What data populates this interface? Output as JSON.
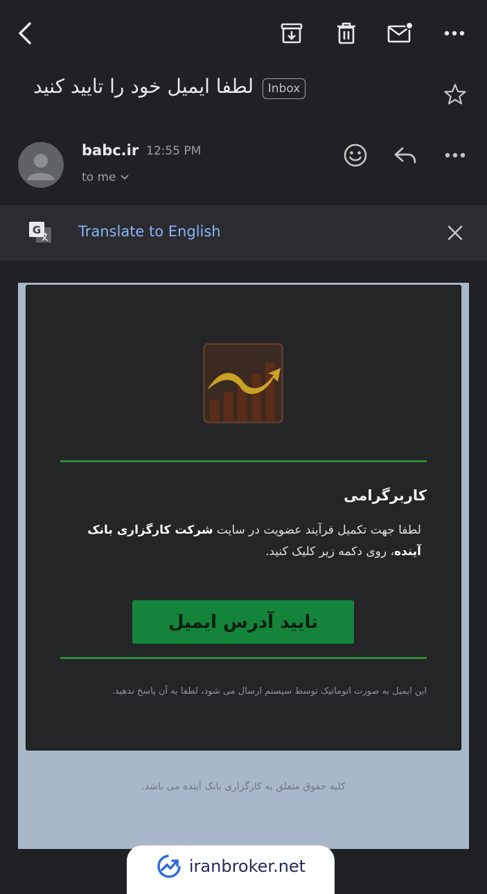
{
  "toolbar": {
    "back": "back-arrow-icon",
    "archive": "archive-icon",
    "delete": "trash-icon",
    "mark_unread": "mail-unread-icon",
    "more": "more-vert-icon"
  },
  "subject": {
    "text": "لطفا ایمیل خود را تایید کنید",
    "label": "Inbox"
  },
  "sender": {
    "name": "babc.ir",
    "time": "12:55 PM",
    "recipient": "to me"
  },
  "translate": {
    "link_text": "Translate to English"
  },
  "email": {
    "greeting": "کاربرگرامی",
    "paragraph_part1": "لطفا جهت تکمیل فرآیند عضویت در سایت ",
    "paragraph_bold": "شرکت کارگزاری بانک آینده",
    "paragraph_part2": "، روی دکمه زیر کلیک کنید.",
    "button_label": "تایید آدرس ایمیل",
    "auto_note": "این ایمیل به صورت اتوماتیک توسط سیستم ارسال می شود، لطفا به آن پاسخ ندهید.",
    "copyright": "کلیه حقوق متعلق به کارگزاری بانک آینده می باشد."
  },
  "watermark": {
    "text": "iranbroker.net"
  },
  "colors": {
    "background": "#202124",
    "accent_link": "#8ab4f8",
    "button_green": "#14843b",
    "divider_green": "#2e8b3a",
    "mail_outer": "#a9b8c9"
  }
}
